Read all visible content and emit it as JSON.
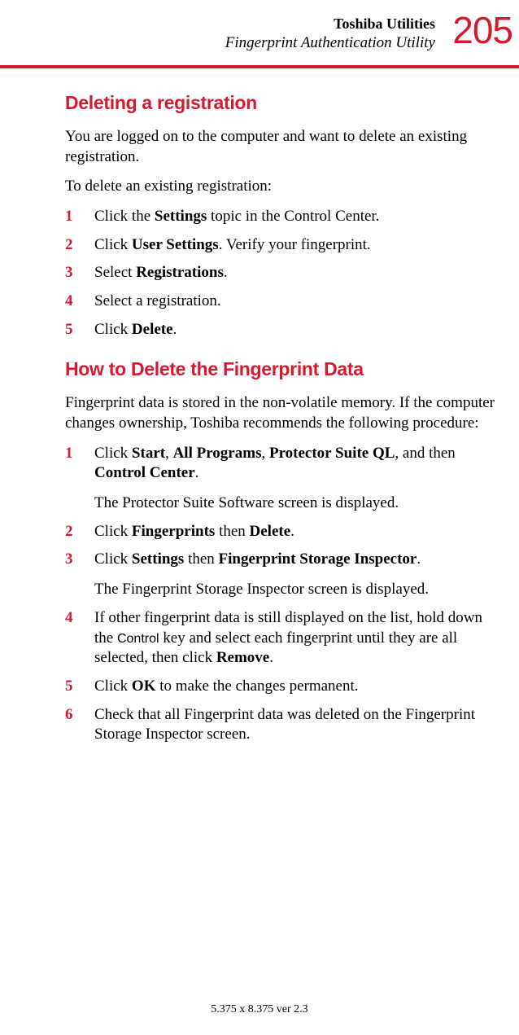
{
  "header": {
    "chapter": "Toshiba Utilities",
    "section": "Fingerprint Authentication Utility",
    "page_number": "205"
  },
  "section1": {
    "heading": "Deleting a registration",
    "intro1": "You are logged on to the computer and want to delete an existing registration.",
    "intro2": "To delete an existing registration:",
    "steps": {
      "n1": "1",
      "s1_a": "Click the ",
      "s1_b": "Settings",
      "s1_c": " topic in the Control Center.",
      "n2": "2",
      "s2_a": "Click ",
      "s2_b": "User Settings",
      "s2_c": ". Verify your fingerprint.",
      "n3": "3",
      "s3_a": "Select ",
      "s3_b": "Registrations",
      "s3_c": ".",
      "n4": "4",
      "s4": "Select a registration.",
      "n5": "5",
      "s5_a": "Click ",
      "s5_b": "Delete",
      "s5_c": "."
    }
  },
  "section2": {
    "heading": "How to Delete the Fingerprint Data",
    "intro": "Fingerprint data is stored in the non-volatile memory. If the computer changes ownership, Toshiba recommends the following procedure:",
    "steps": {
      "n1": "1",
      "s1_a": "Click ",
      "s1_b": "Start",
      "s1_c": ", ",
      "s1_d": "All Programs",
      "s1_e": ", ",
      "s1_f": "Protector Suite QL",
      "s1_g": ", and then ",
      "s1_h": "Control Center",
      "s1_i": ".",
      "s1_sub": "The Protector Suite Software screen is displayed.",
      "n2": "2",
      "s2_a": "Click ",
      "s2_b": "Fingerprints",
      "s2_c": " then ",
      "s2_d": "Delete",
      "s2_e": ".",
      "n3": "3",
      "s3_a": "Click ",
      "s3_b": "Settings",
      "s3_c": " then ",
      "s3_d": "Fingerprint Storage Inspector",
      "s3_e": ".",
      "s3_sub": "The Fingerprint Storage Inspector screen is displayed.",
      "n4": "4",
      "s4_a": "If other fingerprint data is still displayed on the list, hold down the ",
      "s4_b": "Control",
      "s4_c": " key and select each fingerprint until they are all selected, then click ",
      "s4_d": "Remove",
      "s4_e": ".",
      "n5": "5",
      "s5_a": "Click ",
      "s5_b": "OK",
      "s5_c": " to make the changes permanent.",
      "n6": "6",
      "s6": "Check that all Fingerprint data was deleted on the Fingerprint Storage Inspector screen."
    }
  },
  "footer": "5.375 x 8.375 ver 2.3"
}
